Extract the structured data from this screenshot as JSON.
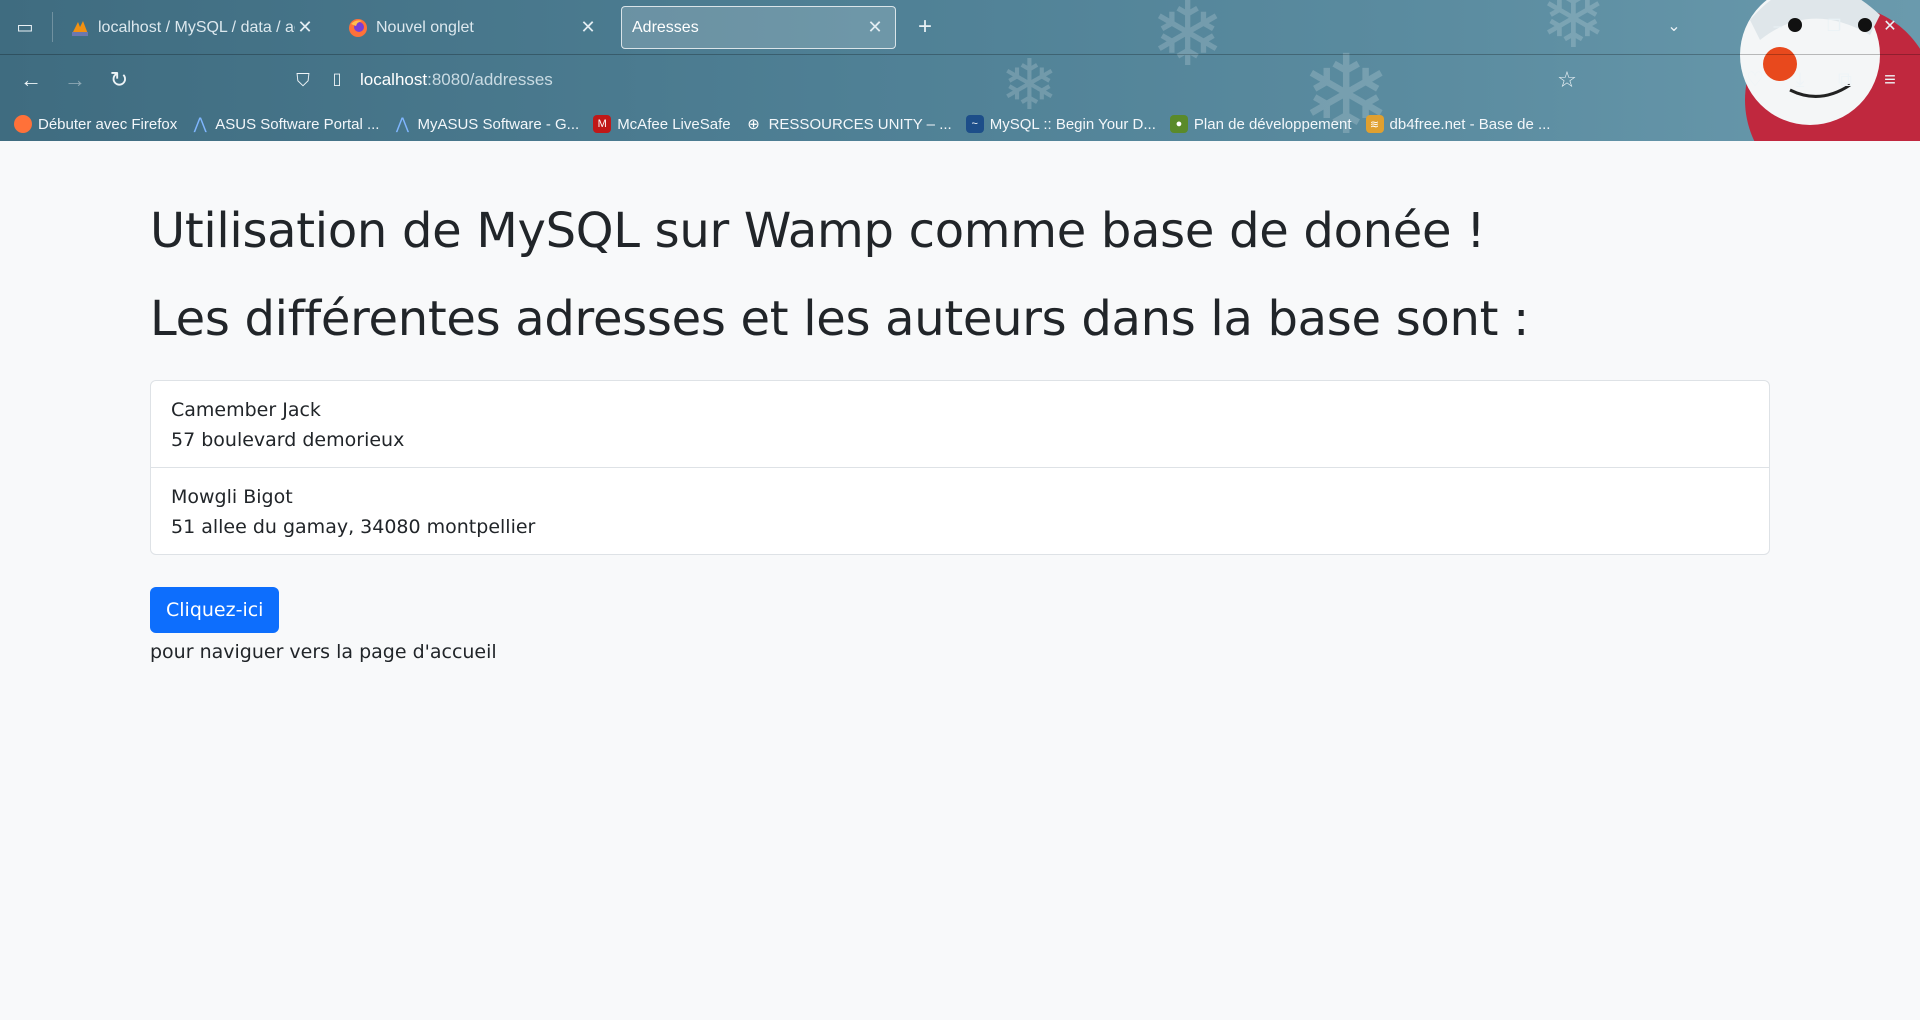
{
  "browser": {
    "tabs": [
      {
        "title": "localhost / MySQL / data / addresses",
        "favicon": "phpmyadmin-icon",
        "active": false
      },
      {
        "title": "Nouvel onglet",
        "favicon": "firefox-icon",
        "active": false
      },
      {
        "title": "Adresses",
        "favicon": "",
        "active": true
      }
    ],
    "url": {
      "host": "localhost",
      "path": ":8080/addresses"
    },
    "bookmarks": [
      {
        "label": "Débuter avec Firefox",
        "icon": "firefox-icon"
      },
      {
        "label": "ASUS Software Portal ...",
        "icon": "asus-icon"
      },
      {
        "label": "MyASUS Software - G...",
        "icon": "asus-icon"
      },
      {
        "label": "McAfee LiveSafe",
        "icon": "mcafee-icon"
      },
      {
        "label": "RESSOURCES UNITY – ...",
        "icon": "globe-icon"
      },
      {
        "label": "MySQL :: Begin Your D...",
        "icon": "mysql-icon"
      },
      {
        "label": "Plan de développement",
        "icon": "plan-icon"
      },
      {
        "label": "db4free.net - Base de ...",
        "icon": "db4free-icon"
      }
    ]
  },
  "page": {
    "title": "Utilisation de MySQL sur Wamp comme base de donée !",
    "subtitle": "Les différentes adresses et les auteurs dans la base sont :",
    "addresses": [
      {
        "author": "Camember Jack",
        "address": "57 boulevard demorieux"
      },
      {
        "author": "Mowgli Bigot",
        "address": "51 allee du gamay, 34080 montpellier"
      }
    ],
    "button_label": "Cliquez-ici",
    "button_caption": "pour naviguer vers la page d'accueil"
  },
  "colors": {
    "primary": "#0d6efd",
    "page_bg": "#f8f9fa",
    "chrome": "#4f8095"
  }
}
